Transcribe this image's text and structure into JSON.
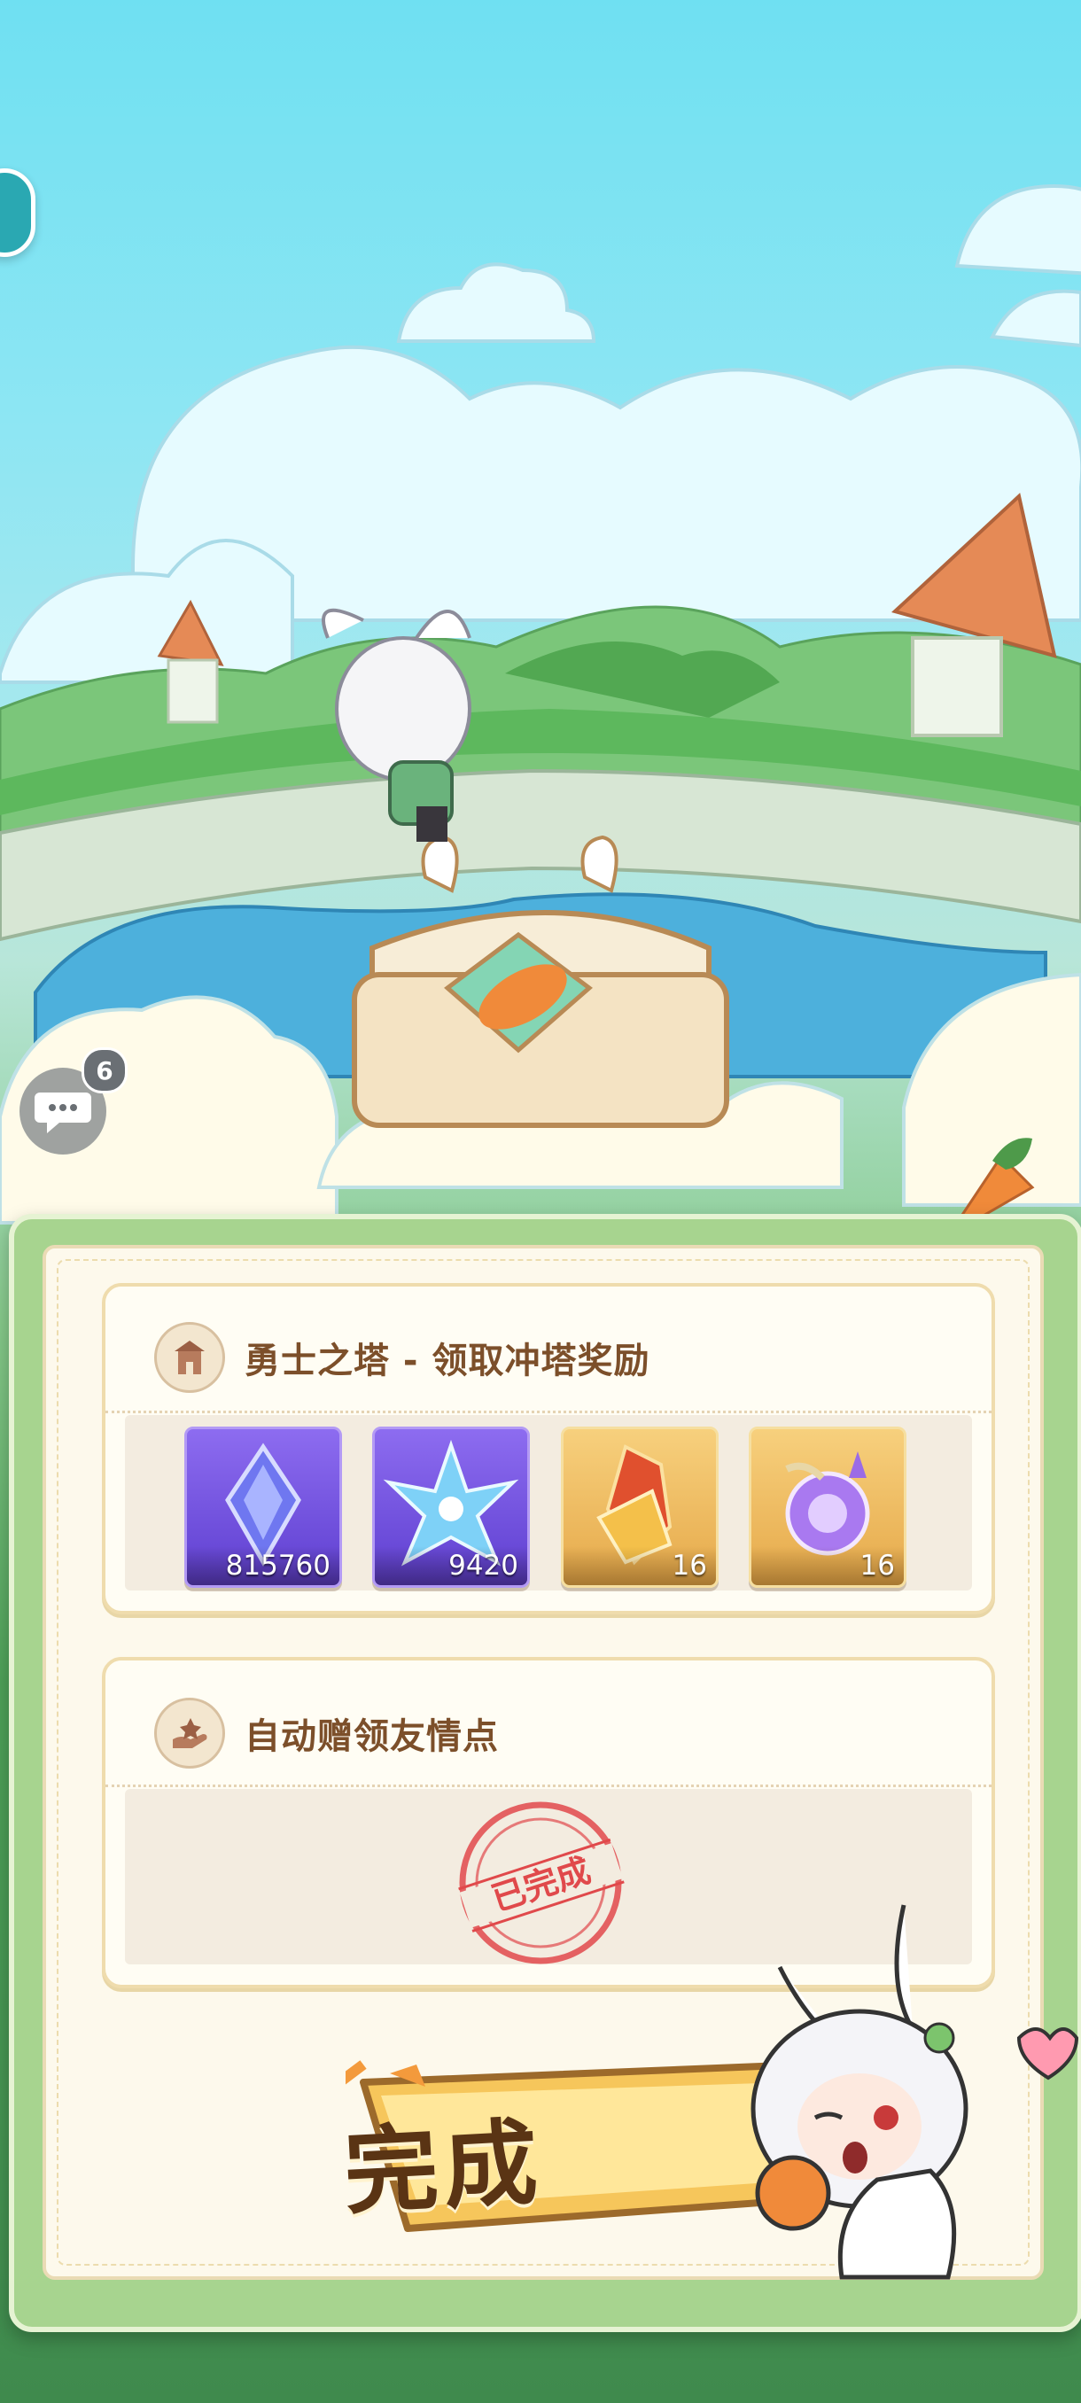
{
  "chat": {
    "badge_count": "6"
  },
  "tower_card": {
    "title": "勇士之塔 - 领取冲塔奖励",
    "rewards": [
      {
        "icon": "purple-crystal-icon",
        "count": "815760"
      },
      {
        "icon": "ice-star-crystal-icon",
        "count": "9420"
      },
      {
        "icon": "amber-crystal-icon",
        "count": "16"
      },
      {
        "icon": "purple-orb-icon",
        "count": "16"
      }
    ]
  },
  "friend_card": {
    "title": "自动赠领友情点",
    "stamp_text": "已完成"
  },
  "complete_button": {
    "label": "完成"
  },
  "colors": {
    "sky": "#6fe0f2",
    "panel": "#fdf9ec",
    "title_brown": "#7c4f2a",
    "stamp_red": "#e0494b",
    "button_yellow": "#f6c65b"
  }
}
